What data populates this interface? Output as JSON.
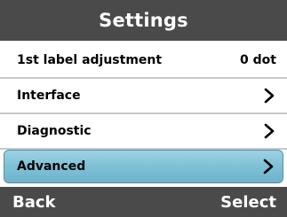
{
  "header": {
    "title": "Settings"
  },
  "menu": {
    "items": [
      {
        "label": "1st label adjustment",
        "value": "0 dot"
      },
      {
        "label": "Interface"
      },
      {
        "label": "Diagnostic"
      },
      {
        "label": "Advanced"
      }
    ]
  },
  "softkeys": {
    "left": "Back",
    "right": "Select"
  },
  "colors": {
    "bar": "#4a4a4a",
    "selection": "#85c5d9",
    "divider": "#c8c8c8"
  },
  "icons": {
    "chevron": "chevron-right-icon"
  }
}
